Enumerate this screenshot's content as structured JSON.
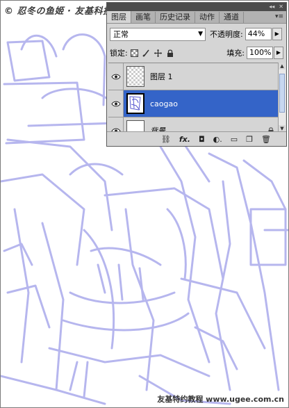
{
  "watermark_top": "© 忍冬の鱼姬 · 友基科技",
  "watermark_bottom": "友基特约教程 www.ugee.com.cn",
  "panel": {
    "tabs": [
      {
        "label": "图层"
      },
      {
        "label": "画笔"
      },
      {
        "label": "历史记录"
      },
      {
        "label": "动作"
      },
      {
        "label": "通道"
      }
    ],
    "blend_mode": "正常",
    "opacity_label": "不透明度:",
    "opacity_value": "44%",
    "lock_label": "锁定:",
    "fill_label": "填充:",
    "fill_value": "100%",
    "layers": [
      {
        "name": "图层 1",
        "selected": false,
        "thumb": "transparent"
      },
      {
        "name": "caogao",
        "selected": true,
        "thumb": "sketch"
      },
      {
        "name": "背景",
        "selected": false,
        "thumb": "white",
        "locked": true
      }
    ]
  },
  "colors": {
    "sketch_line": "#b3b3ee",
    "selected_layer": "#3464c8",
    "panel_bg": "#d5d5d5"
  }
}
